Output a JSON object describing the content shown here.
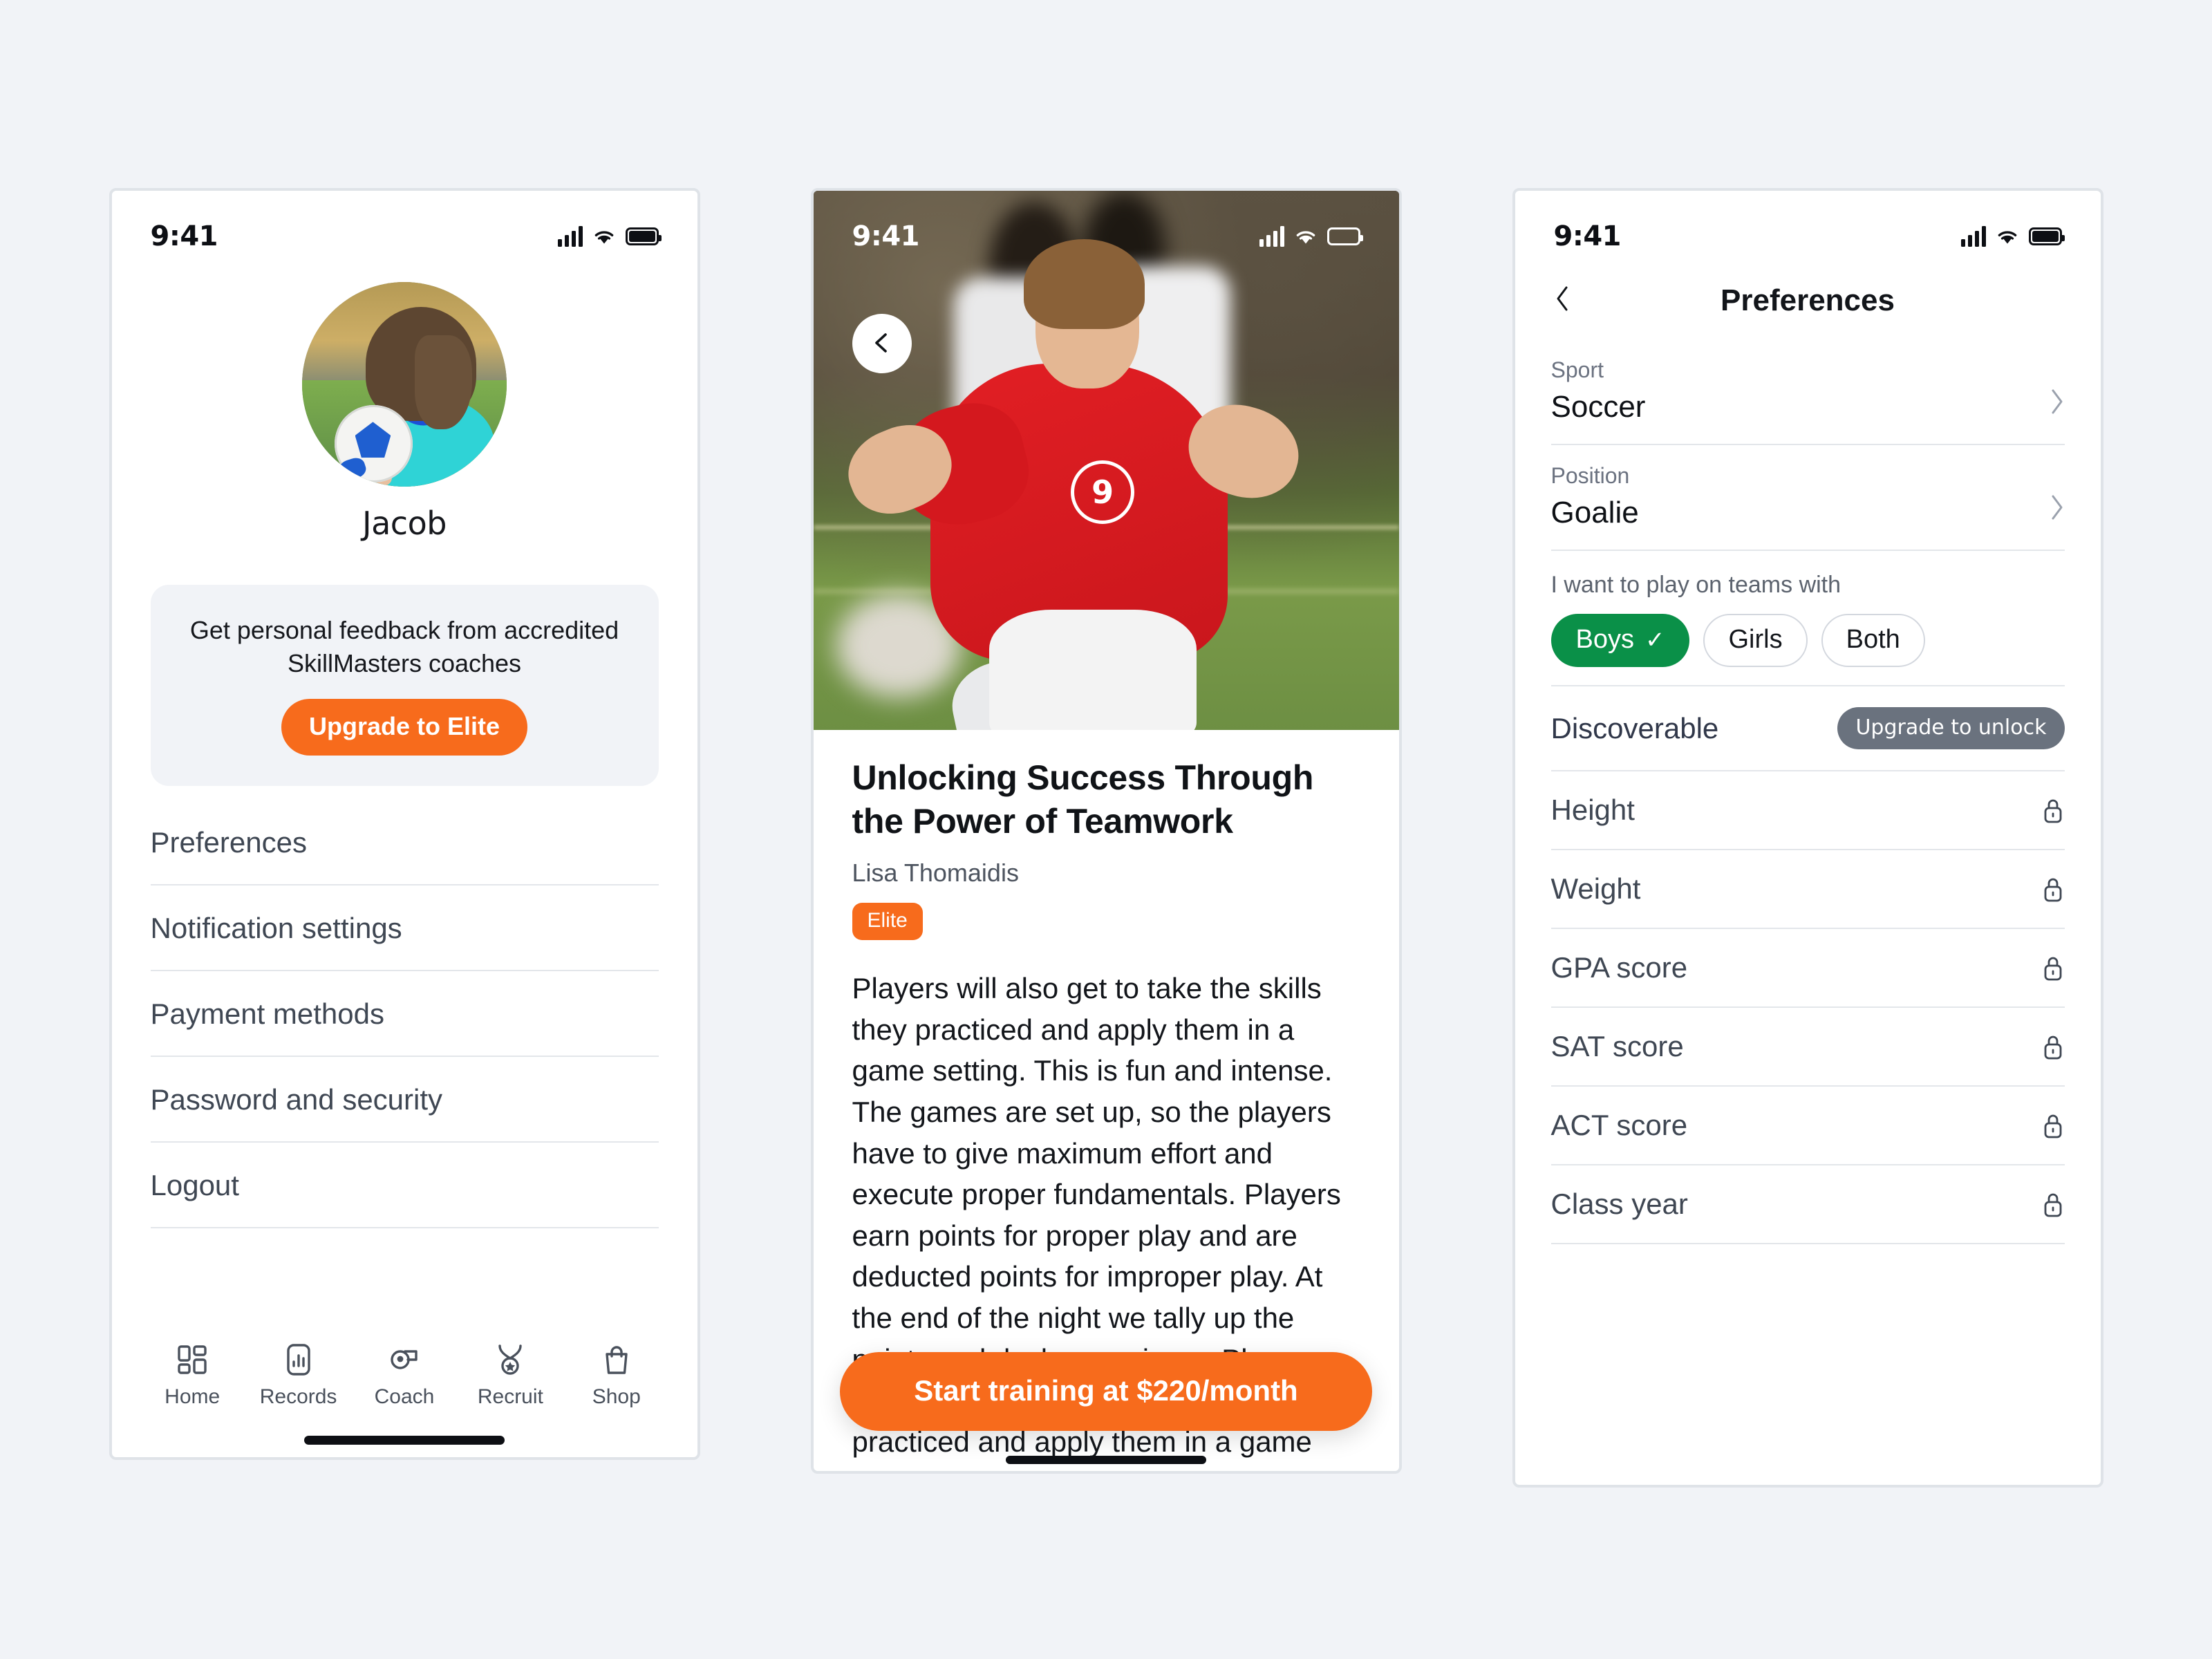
{
  "statusbar": {
    "time": "9:41"
  },
  "profile": {
    "name": "Jacob",
    "promo_text": "Get personal feedback from accredited SkillMasters coaches",
    "upgrade_button": "Upgrade to Elite",
    "menu": [
      {
        "label": "Preferences"
      },
      {
        "label": "Notification settings"
      },
      {
        "label": "Payment methods"
      },
      {
        "label": "Password and security"
      },
      {
        "label": "Logout"
      }
    ],
    "tabs": [
      {
        "label": "Home",
        "icon": "grid-icon"
      },
      {
        "label": "Records",
        "icon": "bar-chart-icon"
      },
      {
        "label": "Coach",
        "icon": "whistle-icon"
      },
      {
        "label": "Recruit",
        "icon": "medal-icon"
      },
      {
        "label": "Shop",
        "icon": "shopping-bag-icon"
      }
    ]
  },
  "article": {
    "back_icon": "chevron-left-icon",
    "jersey_number": "9",
    "title": "Unlocking Success Through the Power of Teamwork",
    "author": "Lisa Thomaidis",
    "tag": "Elite",
    "body": "Players will also get to take the skills they practiced and apply them in a game setting. This is fun and intense. The games are set up, so the players have to give maximum effort and execute proper fundamentals. Players earn points for proper play and are deducted points for improper play. At the end of the night we tally up the points and declare a winner. Players will also get to take the skills they practiced and apply them in a game setting. This is fun",
    "cta": "Start training at $220/month"
  },
  "preferences": {
    "title": "Preferences",
    "back_icon": "chevron-left-icon",
    "fields": [
      {
        "label": "Sport",
        "value": "Soccer",
        "chevron": "chevron-right-icon"
      },
      {
        "label": "Position",
        "value": "Goalie",
        "chevron": "chevron-right-icon"
      }
    ],
    "teams_question": "I want to play on teams with",
    "team_options": [
      {
        "label": "Boys",
        "selected": true,
        "check": "✓"
      },
      {
        "label": "Girls",
        "selected": false
      },
      {
        "label": "Both",
        "selected": false
      }
    ],
    "discoverable_label": "Discoverable",
    "discoverable_badge": "Upgrade to unlock",
    "locked_rows": [
      {
        "label": "Height",
        "icon": "lock-icon"
      },
      {
        "label": "Weight",
        "icon": "lock-icon"
      },
      {
        "label": "GPA score",
        "icon": "lock-icon"
      },
      {
        "label": "SAT score",
        "icon": "lock-icon"
      },
      {
        "label": "ACT score",
        "icon": "lock-icon"
      },
      {
        "label": "Class year",
        "icon": "lock-icon"
      }
    ]
  },
  "colors": {
    "page_bg": "#f1f3f7",
    "accent_orange": "#f76b1c",
    "accent_green": "#0a9048",
    "badge_gray": "#6a727e",
    "text_dark": "#16181d"
  }
}
